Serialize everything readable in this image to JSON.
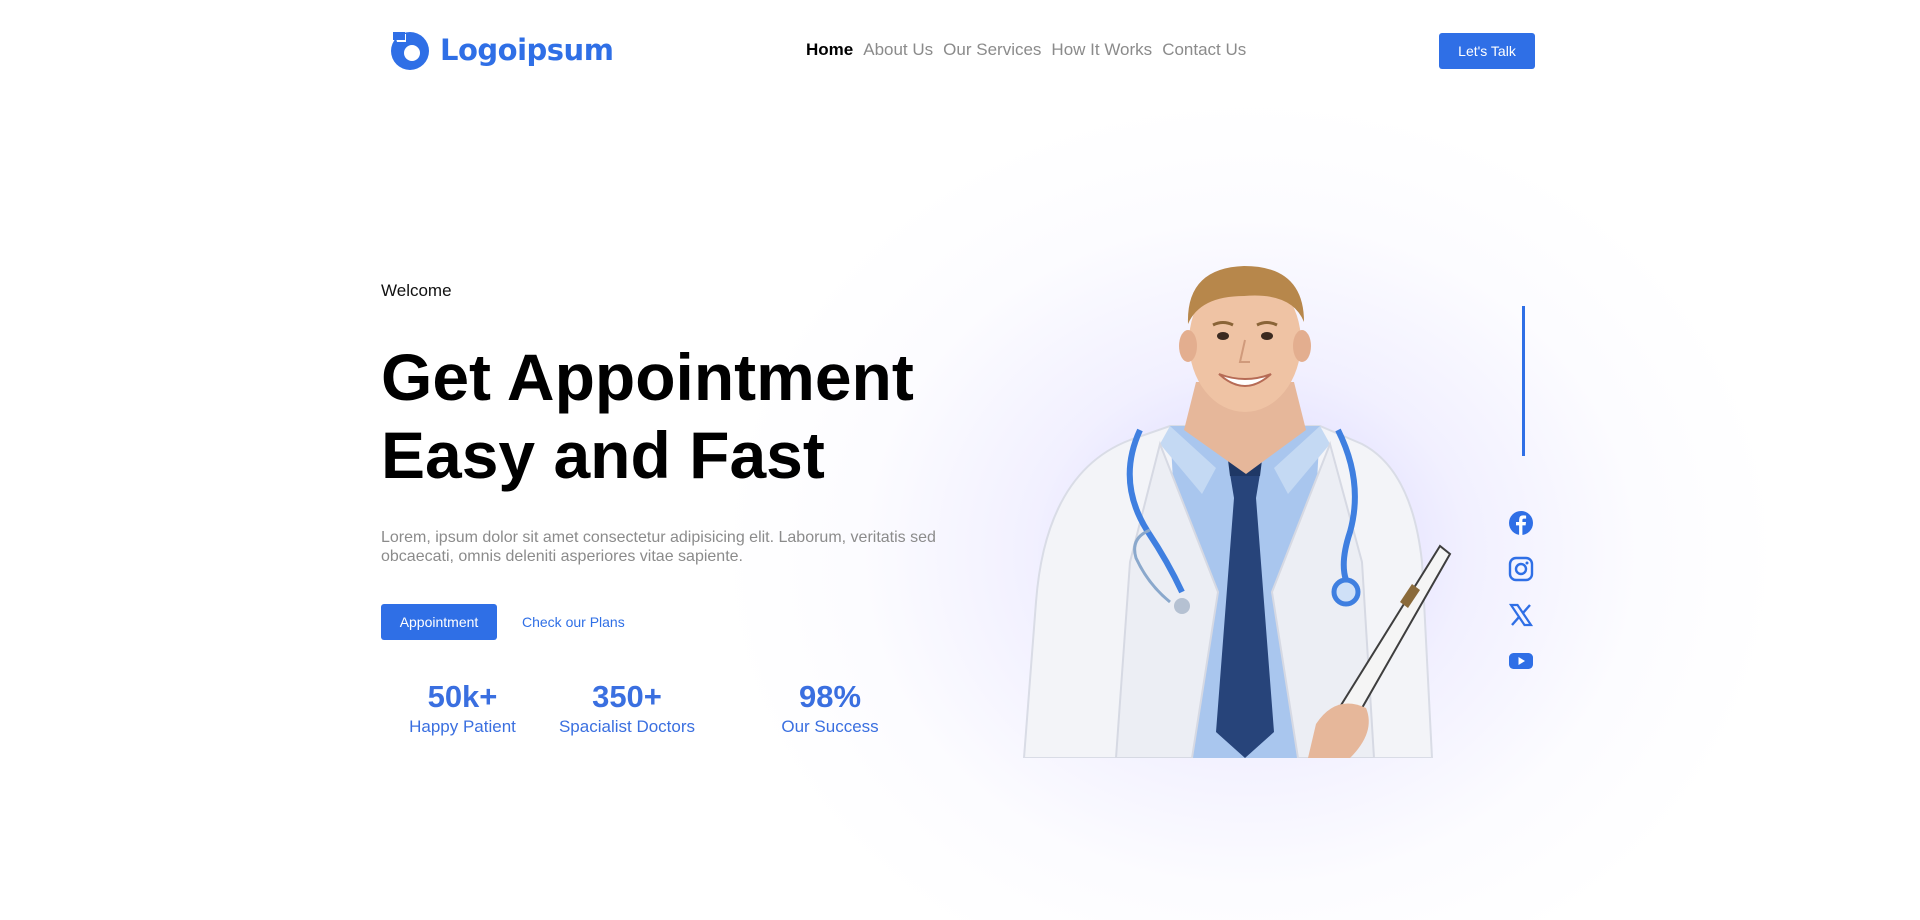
{
  "brand": {
    "name": "Logoipsum",
    "accent": "#2f6fe6"
  },
  "nav": {
    "items": [
      {
        "label": "Home",
        "active": true
      },
      {
        "label": "About Us",
        "active": false
      },
      {
        "label": "Our Services",
        "active": false
      },
      {
        "label": "How It Works",
        "active": false
      },
      {
        "label": "Contact Us",
        "active": false
      }
    ],
    "cta_label": "Let's Talk"
  },
  "hero": {
    "eyebrow": "Welcome",
    "headline_line1": "Get Appointment",
    "headline_line2": "Easy and Fast",
    "lead": "Lorem, ipsum dolor sit amet consectetur adipisicing elit. Laborum, veritatis sed obcaecati, omnis deleniti asperiores vitae sapiente.",
    "primary_cta": "Appointment",
    "secondary_cta": "Check our Plans"
  },
  "stats": [
    {
      "value": "50k+",
      "label": "Happy Patient"
    },
    {
      "value": "350+",
      "label": "Spacialist Doctors"
    },
    {
      "value": "98%",
      "label": "Our Success"
    }
  ],
  "social": {
    "icons": [
      "facebook-icon",
      "instagram-icon",
      "x-icon",
      "youtube-icon"
    ]
  }
}
